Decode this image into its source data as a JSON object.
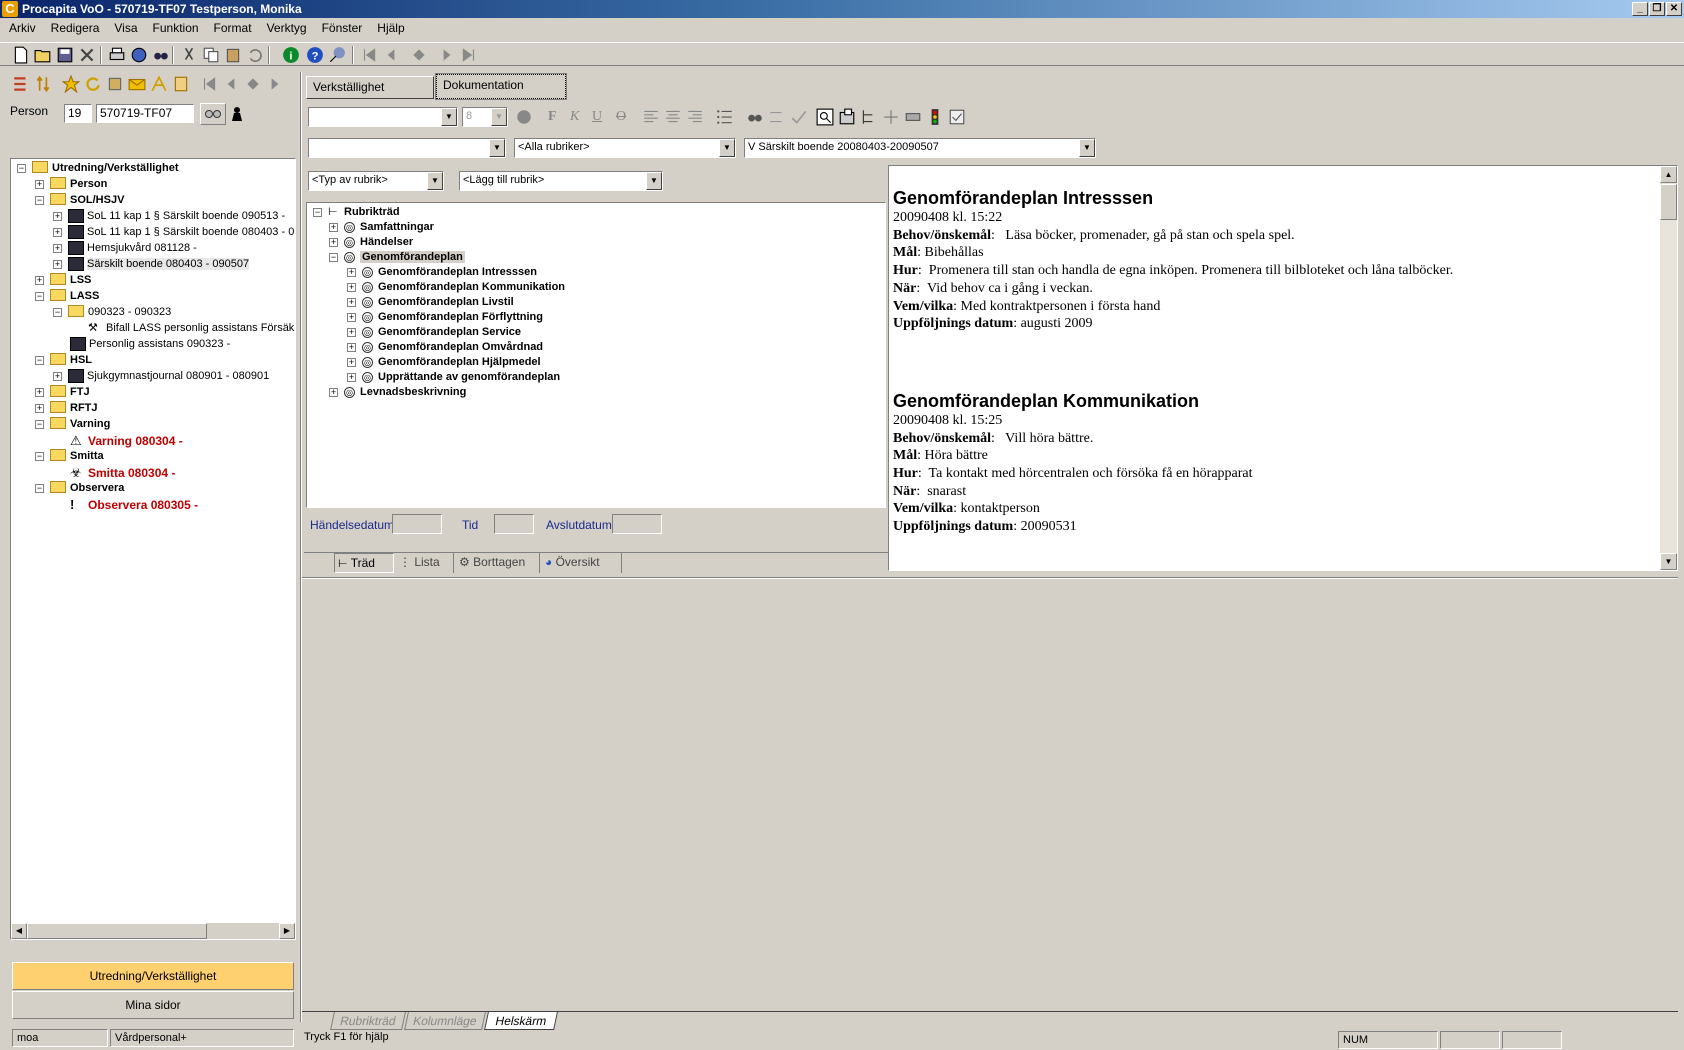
{
  "window": {
    "title": "Procapita VoO - 570719-TF07 Testperson, Monika",
    "app_icon": "C",
    "controls": [
      "_",
      "❐",
      "✕"
    ]
  },
  "menu": [
    "Arkiv",
    "Redigera",
    "Visa",
    "Funktion",
    "Format",
    "Verktyg",
    "Fönster",
    "Hjälp"
  ],
  "person": {
    "label": "Person",
    "century": "19",
    "id": "570719-TF07"
  },
  "left_tree": {
    "root": "Utredning/Verkställighet",
    "items": [
      {
        "label": "Person",
        "level": 1,
        "type": "folder",
        "expander": "+"
      },
      {
        "label": "SOL/HSJV",
        "level": 1,
        "type": "folder",
        "expander": "−"
      },
      {
        "label": "SoL 11 kap 1 § Särskilt boende 090513 -",
        "level": 2,
        "type": "doc",
        "expander": "+"
      },
      {
        "label": "SoL 11 kap 1 § Särskilt boende 080403 - 0",
        "level": 2,
        "type": "doc",
        "expander": "+"
      },
      {
        "label": "Hemsjukvård 081128 -",
        "level": 2,
        "type": "doc",
        "expander": "+"
      },
      {
        "label": "Särskilt boende 080403 - 090507",
        "level": 2,
        "type": "doc",
        "expander": "+"
      },
      {
        "label": "LSS",
        "level": 1,
        "type": "folder",
        "expander": "+"
      },
      {
        "label": "LASS",
        "level": 1,
        "type": "folder",
        "expander": "−"
      },
      {
        "label": "090323 - 090323",
        "level": 2,
        "type": "folder",
        "expander": "−"
      },
      {
        "label": "Bifall LASS personlig assistans Försäkri",
        "level": 3,
        "type": "hammer",
        "expander": ""
      },
      {
        "label": "Personlig assistans 090323 -",
        "level": 2,
        "type": "doc",
        "expander": ""
      },
      {
        "label": "HSL",
        "level": 1,
        "type": "folder",
        "expander": "−"
      },
      {
        "label": "Sjukgymnastjournal 080901 - 080901",
        "level": 2,
        "type": "doc",
        "expander": "+"
      },
      {
        "label": "FTJ",
        "level": 1,
        "type": "folder",
        "expander": "+"
      },
      {
        "label": "RFTJ",
        "level": 1,
        "type": "folder",
        "expander": "+"
      },
      {
        "label": "Varning",
        "level": 1,
        "type": "folder",
        "expander": "−"
      },
      {
        "label": "Varning 080304 -",
        "level": 2,
        "type": "warning",
        "expander": ""
      },
      {
        "label": "Smitta",
        "level": 1,
        "type": "folder",
        "expander": "−"
      },
      {
        "label": "Smitta 080304 -",
        "level": 2,
        "type": "biohazard",
        "expander": ""
      },
      {
        "label": "Observera",
        "level": 1,
        "type": "folder",
        "expander": "−"
      },
      {
        "label": "Observera 080305 -",
        "level": 2,
        "type": "exclaim",
        "expander": ""
      }
    ]
  },
  "left_buttons": {
    "active": "Utredning/Verkställighet",
    "other": "Mina sidor"
  },
  "status_left": [
    "moa",
    "Vårdpersonal+"
  ],
  "tabs": [
    "Verkställighet",
    "Dokumentation"
  ],
  "format": {
    "font_size": "8",
    "bold": "F",
    "italic": "K",
    "underline": "U",
    "strike": "O"
  },
  "filters": {
    "rubriker": "<Alla rubriker>",
    "insats": "V Särskilt boende 20080403-20090507",
    "typ": "<Typ av rubrik>",
    "lagg_till": "<Lägg till rubrik>"
  },
  "rubrik_tree": {
    "root": "Rubrikträd",
    "items": [
      {
        "label": "Samfattningar",
        "level": 1,
        "expander": "+"
      },
      {
        "label": "Händelser",
        "level": 1,
        "expander": "+"
      },
      {
        "label": "Genomförandeplan",
        "level": 1,
        "expander": "−",
        "selected": true
      },
      {
        "label": "Genomförandeplan Intresssen",
        "level": 2,
        "expander": "+"
      },
      {
        "label": "Genomförandeplan Kommunikation",
        "level": 2,
        "expander": "+"
      },
      {
        "label": "Genomförandeplan Livstil",
        "level": 2,
        "expander": "+"
      },
      {
        "label": "Genomförandeplan Förflyttning",
        "level": 2,
        "expander": "+"
      },
      {
        "label": "Genomförandeplan Service",
        "level": 2,
        "expander": "+"
      },
      {
        "label": "Genomförandeplan Omvårdnad",
        "level": 2,
        "expander": "+"
      },
      {
        "label": "Genomförandeplan Hjälpmedel",
        "level": 2,
        "expander": "+"
      },
      {
        "label": "Upprättande av genomförandeplan",
        "level": 2,
        "expander": "+"
      },
      {
        "label": "Levnadsbeskrivning",
        "level": 1,
        "expander": "+"
      }
    ]
  },
  "event_fields": {
    "handelsedatum": "Händelsedatum",
    "tid": "Tid",
    "avslutdatum": "Avslutdatum"
  },
  "view_tabs": [
    "Träd",
    "Lista",
    "Borttagen",
    "Översikt"
  ],
  "document": [
    {
      "heading": "Genomförandeplan Intresssen",
      "timestamp": "20090408 kl. 15:22",
      "lines": [
        {
          "label": "Behov/önskemål",
          "sep": ":   ",
          "value": "Läsa böcker, promenader, gå på stan och spela spel."
        },
        {
          "label": "Mål",
          "sep": ": ",
          "value": "Bibehållas"
        },
        {
          "label": "Hur",
          "sep": ":  ",
          "value": "Promenera till stan och handla de egna inköpen. Promenera till bilbloteket och låna talböcker."
        },
        {
          "label": "När",
          "sep": ":  ",
          "value": "Vid behov ca i gång i veckan."
        },
        {
          "label": "Vem/vilka",
          "sep": ": ",
          "value": "Med kontraktpersonen i första hand"
        },
        {
          "label": "Uppföljnings datum",
          "sep": ": ",
          "value": "augusti 2009"
        }
      ]
    },
    {
      "heading": "Genomförandeplan Kommunikation",
      "timestamp": "20090408 kl. 15:25",
      "lines": [
        {
          "label": "Behov/önskemål",
          "sep": ":   ",
          "value": "Vill höra bättre."
        },
        {
          "label": "Mål",
          "sep": ": ",
          "value": "Höra bättre"
        },
        {
          "label": "Hur",
          "sep": ":  ",
          "value": "Ta kontakt med hörcentralen och försöka få en hörapparat"
        },
        {
          "label": "När",
          "sep": ":  ",
          "value": "snarast"
        },
        {
          "label": "Vem/vilka",
          "sep": ": ",
          "value": "kontaktperson"
        },
        {
          "label": "Uppföljnings datum",
          "sep": ": ",
          "value": "20090531"
        }
      ]
    }
  ],
  "bottom_tabs": [
    "Rubrikträd",
    "Kolumnläge",
    "Helskärm"
  ],
  "status": {
    "help": "Tryck F1 för hjälp",
    "num": "NUM"
  }
}
